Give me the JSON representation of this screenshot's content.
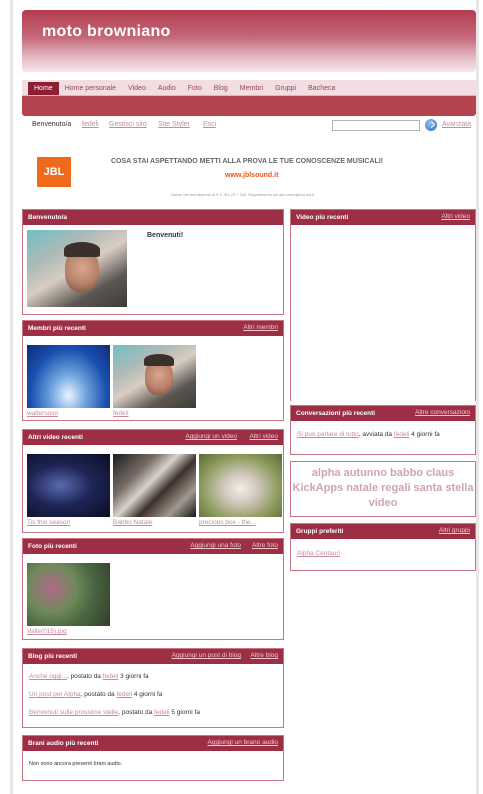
{
  "site": {
    "title": "moto browniano"
  },
  "nav": {
    "tabs": [
      "Home",
      "Home personale",
      "Video",
      "Audio",
      "Foto",
      "Blog",
      "Membri",
      "Gruppi",
      "Bacheca"
    ]
  },
  "userbar": {
    "welcome": "Benvenuto/a",
    "user": "fedeli",
    "links": [
      "Gestisci sito",
      "Site Styler",
      "Esci"
    ],
    "search_value": "",
    "advanced": "Avanzata"
  },
  "banner": {
    "logo": "JBL",
    "headline": "COSA STAI ASPETTANDO METTI ALLA PROVA LE TUE CONOSCENZE MUSICALI!",
    "url": "www.jblsound.it",
    "small": "Valore del montepremi di € 2.761,70 + IVA. Regolamento sul sito www.jblsound.it"
  },
  "welcome_box": {
    "title": "Benvenuto/a",
    "message": "Benvenuti!"
  },
  "members_box": {
    "title": "Membri più recenti",
    "more": "Altri membri",
    "members": [
      "waltersoso",
      "fedeli"
    ]
  },
  "videos_box": {
    "title": "Altri video recenti",
    "add": "Aggiungi un video",
    "more": "Altri video",
    "items": [
      "Tis this season",
      "Babbo Natale",
      "precious box - the..."
    ]
  },
  "photos_box": {
    "title": "Foto più recenti",
    "add": "Aggiungi una foto",
    "more": "Altre foto",
    "items": [
      "Valle(015).jpg"
    ]
  },
  "blog_box": {
    "title": "Blog più recenti",
    "add": "Aggiungi un post di blog",
    "more": "Altre blog",
    "posts": [
      {
        "title": "Anche oggi...",
        "by": ", postato da ",
        "author": "fedeli",
        "when": " 3 giorni fa"
      },
      {
        "title": "Un post per Alpha",
        "by": ", postato da ",
        "author": "fedeli",
        "when": " 4 giorni fa"
      },
      {
        "title": "Benvenuti sulle prossime stelle",
        "by": ", postato da ",
        "author": "fedeli",
        "when": " 5 giorni fa"
      }
    ]
  },
  "audio_box": {
    "title": "Brani audio più recenti",
    "add": "Aggiungi un brano audio",
    "empty": "Non sono ancora presenti brani audio."
  },
  "recent_video_box": {
    "title": "Video più recenti",
    "more": "Altri video"
  },
  "conversations_box": {
    "title": "Conversazioni più recenti",
    "more": "Altre conversazioni",
    "item": {
      "title": "Si può parlare di tutto",
      "by": ", avviata da ",
      "author": "fedeli",
      "when": " 4 giorni fa"
    }
  },
  "tag_cloud": {
    "text": "alpha autunno babbo claus KickApps natale regali santa stella video"
  },
  "groups_box": {
    "title": "Gruppi preferiti",
    "more": "Altri gruppi",
    "items": [
      "Alpha Centauri"
    ]
  }
}
